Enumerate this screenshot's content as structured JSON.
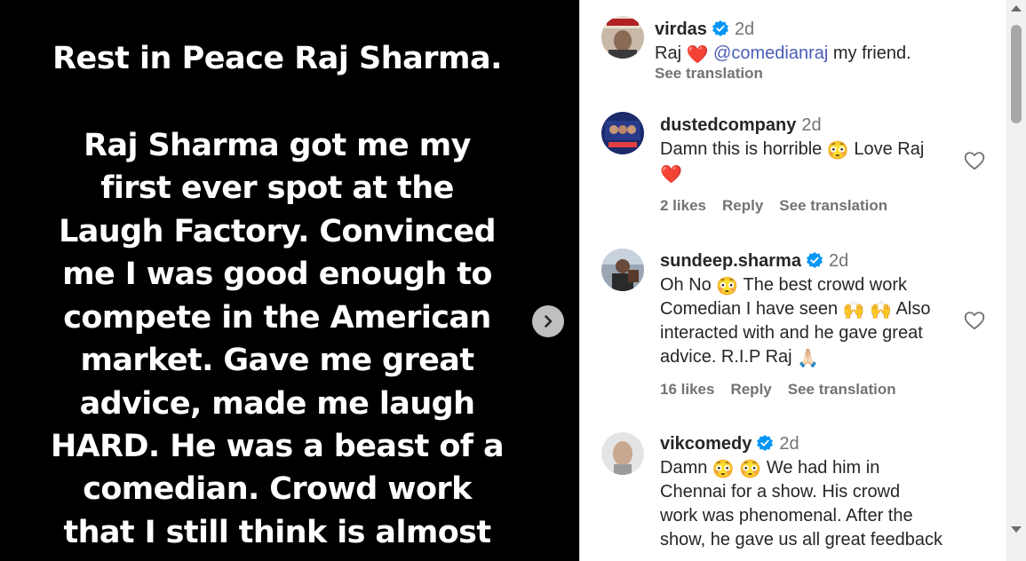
{
  "story": {
    "title": "Rest in Peace Raj Sharma.",
    "lines": [
      "Raj Sharma got me my",
      "first ever spot at the",
      "Laugh Factory. Convinced",
      "me I was good enough to",
      "compete in the American",
      "market. Gave me great",
      "advice, made me laugh",
      "HARD. He was a beast of a",
      "comedian. Crowd work",
      "that I still think is almost"
    ],
    "next_icon": "chevron-right-icon"
  },
  "caption": {
    "username": "virdas",
    "time": "2d",
    "text_before": "Raj",
    "emoji_heart": "❤️",
    "mention": "@comedianraj",
    "text_after": "my friend.",
    "see_translation": "See translation"
  },
  "comments": [
    {
      "username": "dustedcompany",
      "time": "2d",
      "line1": "Damn this is horrible",
      "emoji1": "😳",
      "line1b": "Love Raj",
      "line2_emoji": "❤️",
      "likes": "2 likes",
      "reply": "Reply",
      "see_translation": "See translation"
    },
    {
      "username": "sundeep.sharma",
      "time": "2d",
      "l1a": "Oh No",
      "l1_emoji": "😳",
      "l1b": "The best crowd work",
      "l2a": "Comedian I have seen",
      "l2_emoji": "🙌 🙌",
      "l2b": "Also",
      "l3": "interacted with and he gave great",
      "l4a": "advice. R.I.P Raj",
      "l4_emoji": "🙏🏻",
      "likes": "16 likes",
      "reply": "Reply",
      "see_translation": "See translation"
    },
    {
      "username": "vikcomedy",
      "time": "2d",
      "l1a": "Damn",
      "l1_emoji": "😳 😳",
      "l1b": "We had him in",
      "l2": "Chennai for a show. His crowd",
      "l3": "work was phenomenal. After the",
      "l4": "show, he gave us all great feedback"
    }
  ],
  "icons": {
    "verified": "verified-badge-icon",
    "heart": "heart-outline-icon"
  },
  "colors": {
    "verified_blue": "#0095f6",
    "mention": "#4a5db8",
    "meta_gray": "#737373",
    "heart_red": "#ff3040"
  }
}
